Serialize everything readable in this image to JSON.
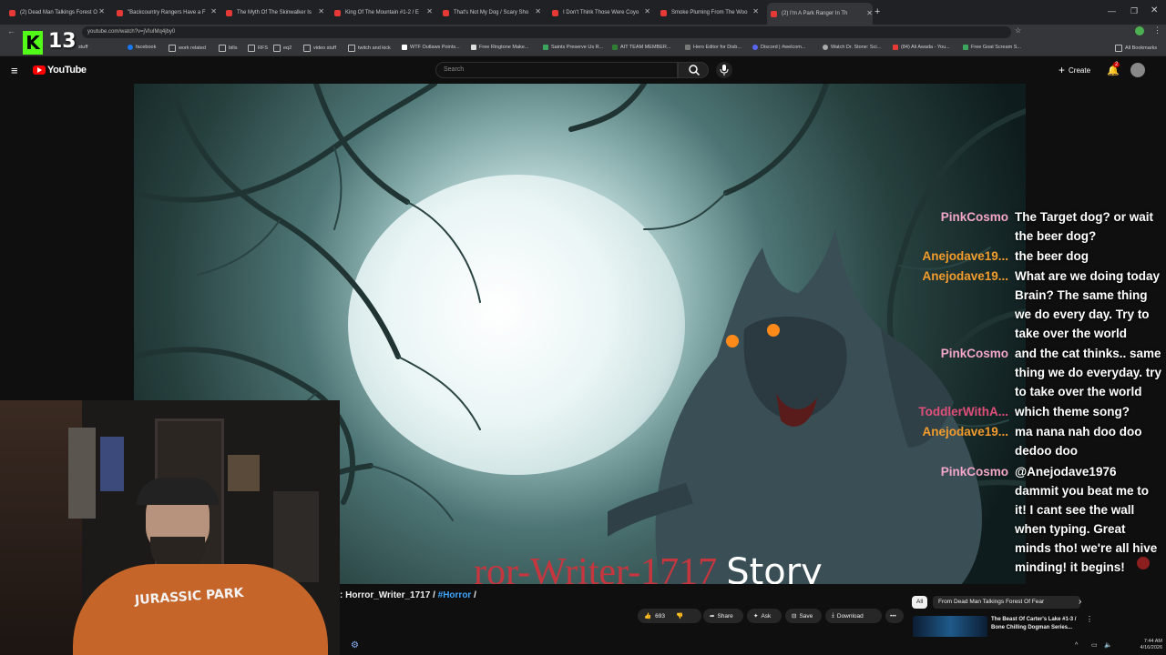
{
  "browser": {
    "tabs": [
      {
        "title": "(2) Dead Man Talkings Forest O"
      },
      {
        "title": "\"Backcountry Rangers Have a F"
      },
      {
        "title": "The Myth Of The Skinwalker Is"
      },
      {
        "title": "King Of The Mountain #1-2 / E"
      },
      {
        "title": "That's Not My Dog / Scary Sho"
      },
      {
        "title": "I Don't Think Those Were Coyo"
      },
      {
        "title": "Smoke Pluming From The Woo"
      },
      {
        "title": "(2) I'm A Park Ranger In Th"
      }
    ],
    "new_tab": "+",
    "url": "youtube.com/watch?v=jVIuIMq4jby0",
    "bookmarks": [
      "stuff",
      "facebook",
      "work related",
      "bills",
      "RFS",
      "eq2",
      "video stuff",
      "twitch and kick",
      "WTF Outlaws Points...",
      "Free Ringtone Make...",
      "Saints Preserve Us R...",
      "AIT TEAM MEMBER...",
      "Hero Editor for Disb...",
      "Discord | #welcom...",
      "Watch Dr. Stone: Sci...",
      "(84) Ali Awada - You...",
      "Free Goat Scream S...",
      "All Bookmarks"
    ]
  },
  "overlay_badge": {
    "count": "13"
  },
  "youtube": {
    "logo": "YouTube",
    "search_placeholder": "Search",
    "create_label": "Create",
    "notif_count": "2"
  },
  "video": {
    "title_overlay_red": "ror-Writer-1717",
    "title_overlay_white": "Story",
    "caption_prefix": ": Horror_Writer_1717 / ",
    "caption_tag": "#Horror",
    "caption_suffix": " /",
    "likes": "693",
    "share": "Share",
    "ask": "Ask",
    "save": "Save",
    "download": "Download"
  },
  "chat": [
    {
      "user": "PinkCosmo",
      "color": "#f4a6c9",
      "text": "The Target dog? or wait the beer dog?"
    },
    {
      "user": "Anejodave19...",
      "color": "#f39c2b",
      "text": "the beer dog"
    },
    {
      "user": "Anejodave19...",
      "color": "#f39c2b",
      "text": "What are we doing today Brain? The same thing we do every day. Try to take over the world"
    },
    {
      "user": "PinkCosmo",
      "color": "#f4a6c9",
      "text": "and the cat thinks.. same thing we do everyday. try to take over the world"
    },
    {
      "user": "ToddlerWithA...",
      "color": "#e04f7a",
      "text": "which theme song?"
    },
    {
      "user": "Anejodave19...",
      "color": "#f39c2b",
      "text": "ma nana nah doo doo dedoo doo"
    },
    {
      "user": "PinkCosmo",
      "color": "#f4a6c9",
      "text": "@Anejodave1976 dammit you beat me to it! I cant see the wall when typing. Great minds tho! we're all hive minding! it begins!"
    }
  ],
  "sidebar_right": {
    "chip_all": "All",
    "chip_from": "From Dead Man Talkings Forest Of Fear",
    "rec_title": "The Beast Of Carter's Lake #1-3 / Bone Chilling Dogman Series..."
  },
  "webcam": {
    "shirt_text": "JURASSIC PARK"
  },
  "clock": {
    "time": "7:44 AM",
    "date": "4/16/2026"
  }
}
